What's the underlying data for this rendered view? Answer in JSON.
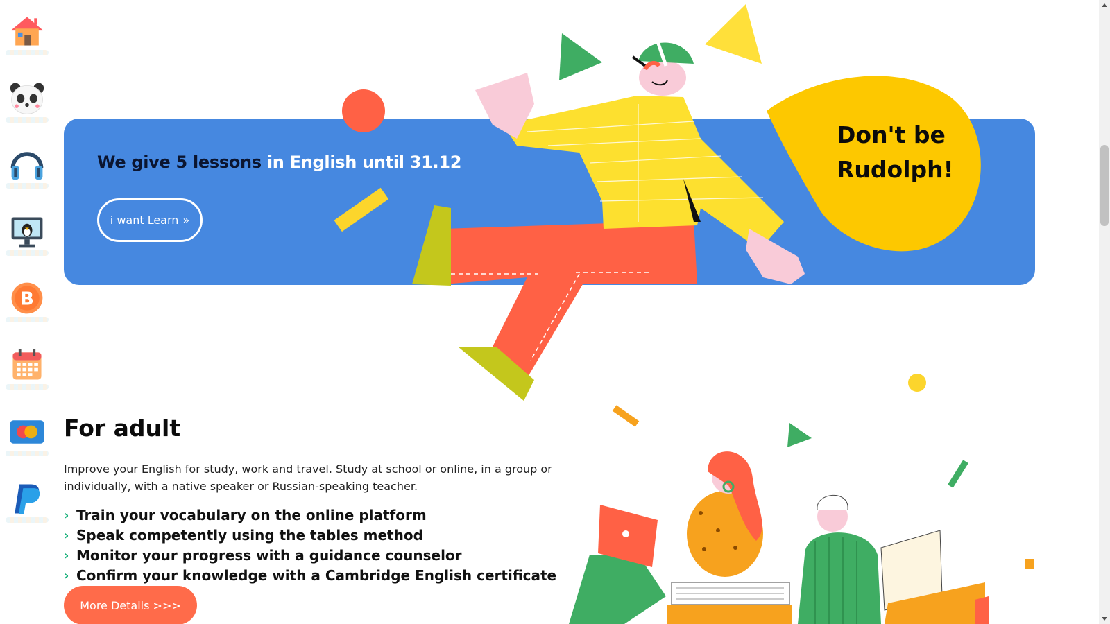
{
  "sidebar": {
    "items": [
      {
        "icon": "home-icon"
      },
      {
        "icon": "panda-icon"
      },
      {
        "icon": "headphones-icon"
      },
      {
        "icon": "monitor-penguin-icon"
      },
      {
        "icon": "bitcoin-icon"
      },
      {
        "icon": "calendar-icon"
      },
      {
        "icon": "mastercard-icon"
      },
      {
        "icon": "paypal-icon"
      }
    ]
  },
  "banner": {
    "title_part1": "We give 5 lessons",
    "title_part2": " in English until 31.12",
    "button_label": "i want Learn",
    "bubble_text": "Don't be Rudolph!",
    "colors": {
      "background": "#4688e0",
      "bubble": "#fdc800"
    }
  },
  "adult": {
    "title": "For adult",
    "description": "Improve your English for study, work and travel. Study at school or online, in a group or individually, with a native speaker or Russian-speaking teacher.",
    "bullets": [
      "Train your vocabulary on the online platform",
      "Speak competently using the tables method",
      "Monitor your progress with a guidance counselor",
      "Confirm your knowledge with a Cambridge English certificate"
    ],
    "button_label": "More Details >>>",
    "colors": {
      "bullet": "#16b07a",
      "button": "#ff6b4a"
    }
  }
}
